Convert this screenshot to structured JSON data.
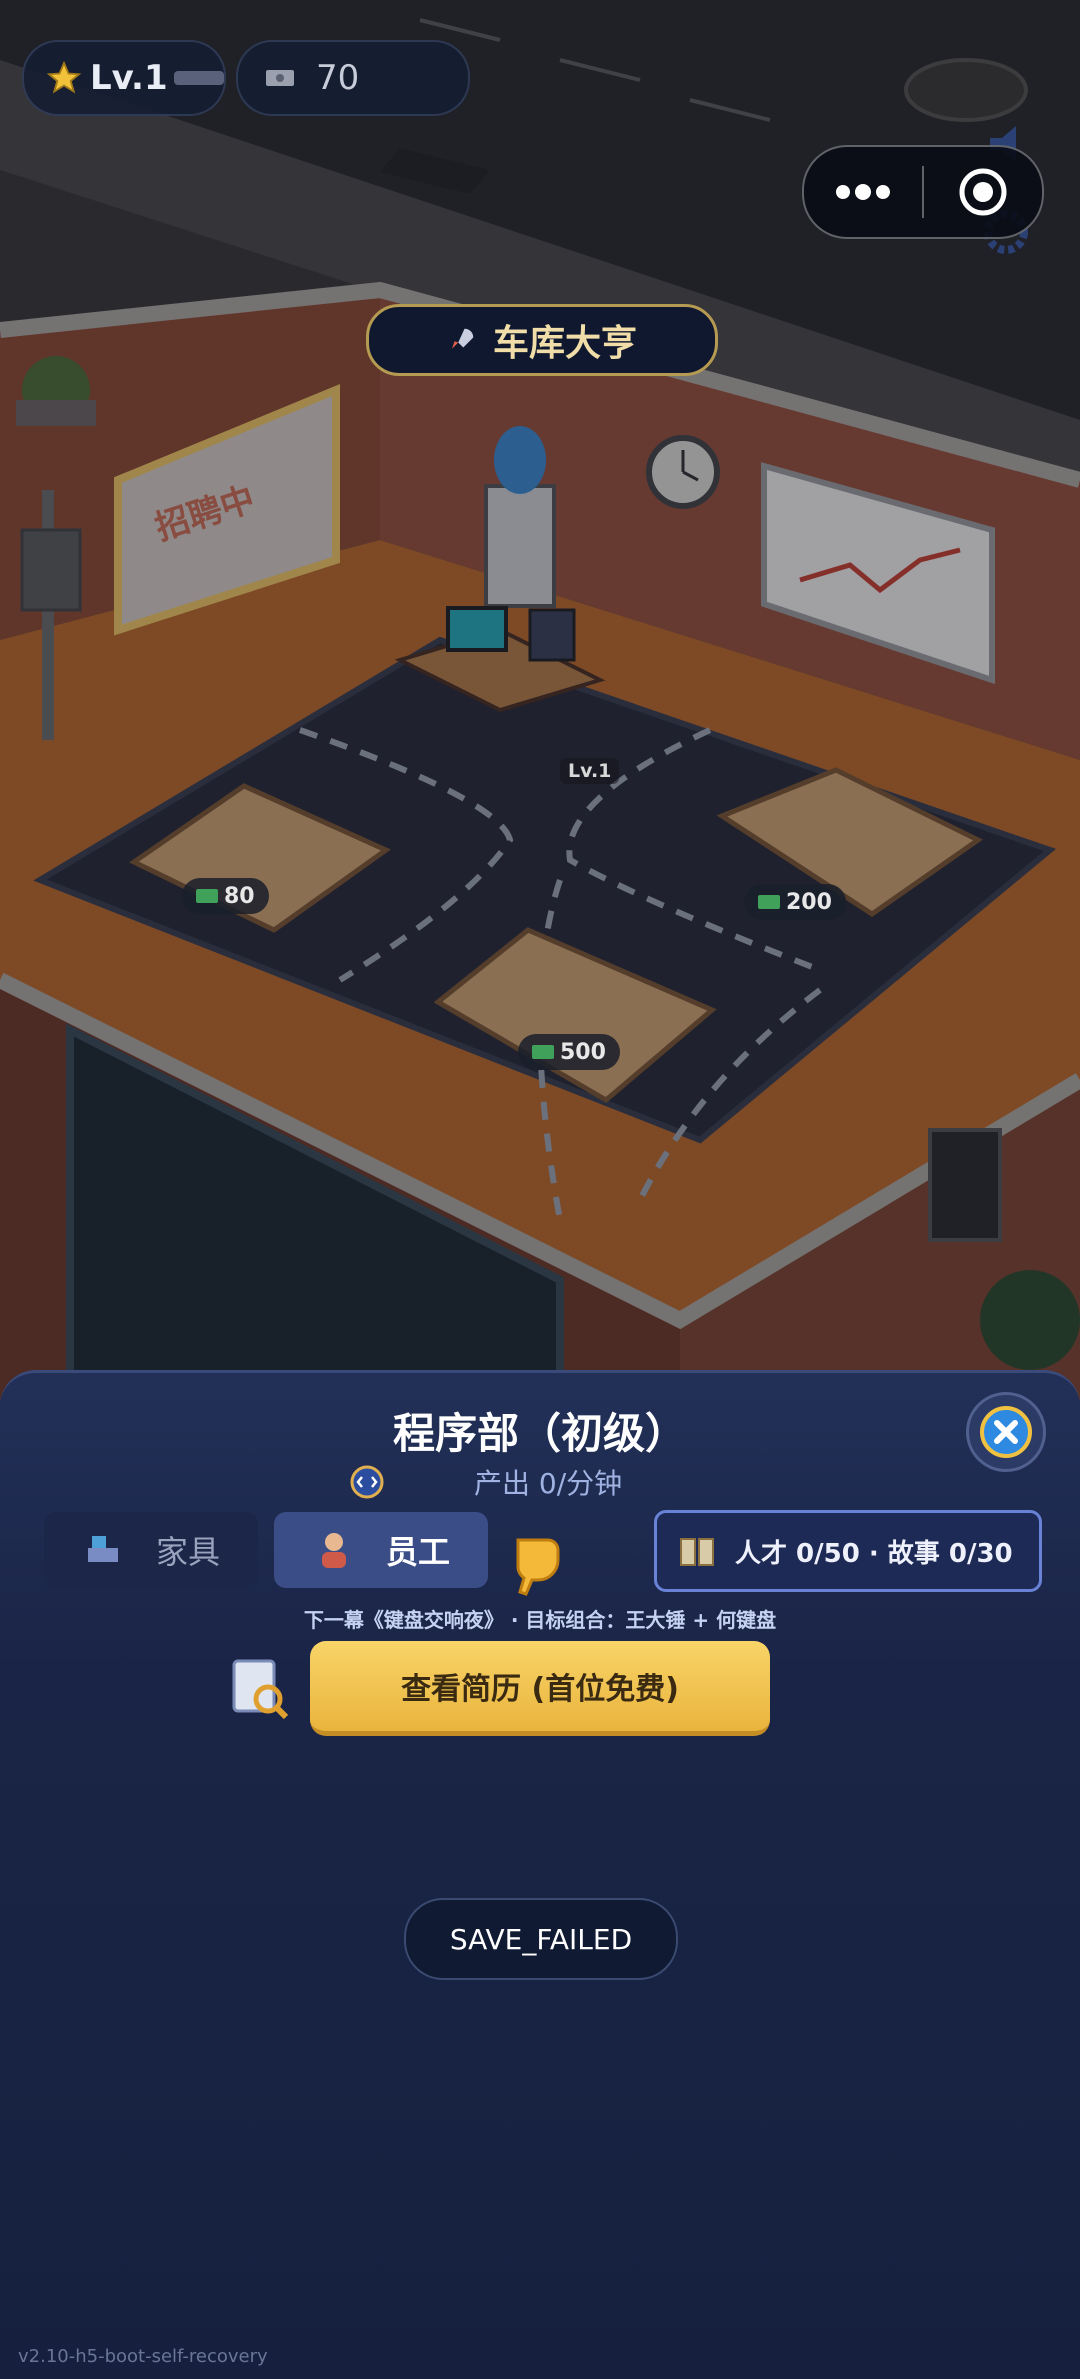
{
  "hud": {
    "level": "Lv.1",
    "currency": "70"
  },
  "location_title": "车库大亨",
  "scene": {
    "desk_level": "Lv.1",
    "slot_prices": [
      "80",
      "200",
      "500"
    ]
  },
  "panel": {
    "title": "程序部（初级）",
    "output": "产出 0/分钟",
    "tabs": [
      {
        "label": "家具",
        "icon": "furniture-icon",
        "active": false
      },
      {
        "label": "员工",
        "icon": "staff-icon",
        "active": true
      }
    ],
    "talent_story": "人才 0/50 · 故事 0/30",
    "hint": "下一幕《键盘交响夜》 · 目标组合：王大锤 + 何键盘",
    "resume_button": "查看简历 (首位免费)"
  },
  "toast": "SAVE_FAILED",
  "version": "v2.10-h5-boot-self-recovery",
  "colors": {
    "panel_bg": "#1a2446",
    "accent_gold": "#eab43d",
    "tab_active": "#3a4d86",
    "talent_border": "#6a82d6"
  }
}
